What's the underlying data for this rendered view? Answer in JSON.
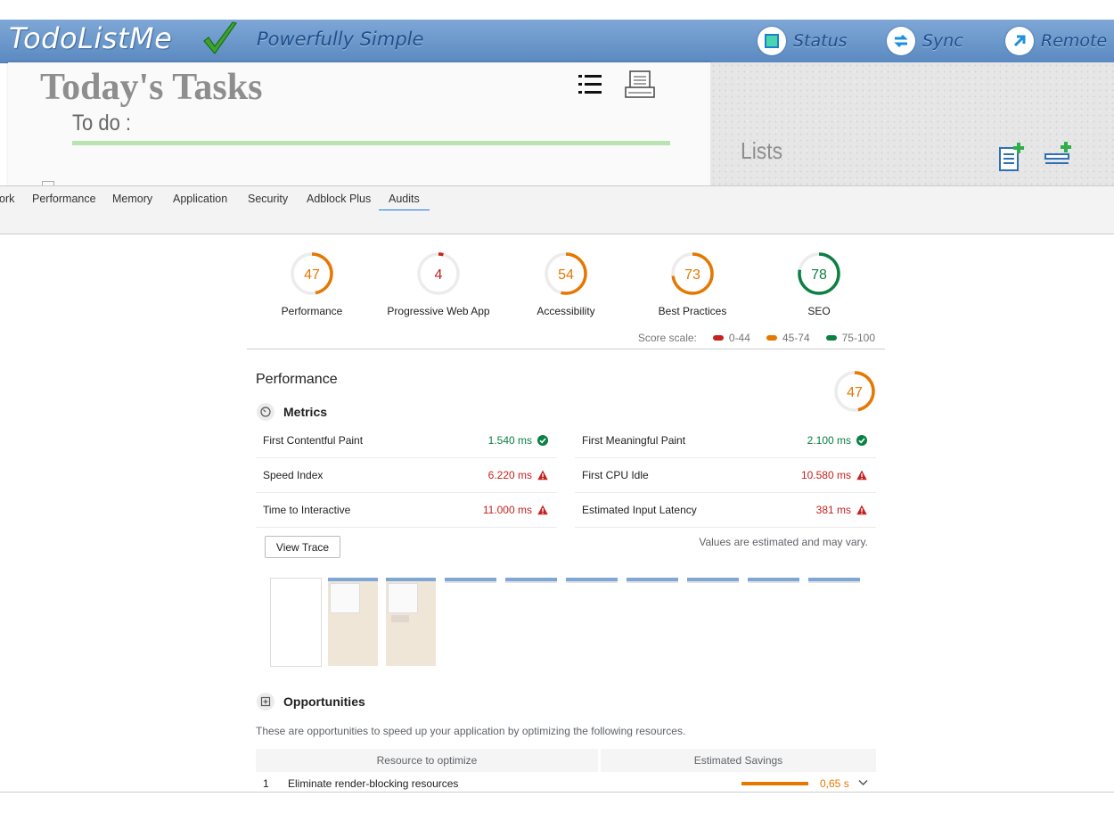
{
  "app": {
    "brand": "TodoListMe",
    "tagline": "Powerfully Simple",
    "header_buttons": [
      "Status",
      "Sync",
      "Remote"
    ],
    "tasks_title": "Today's Tasks",
    "todo_label": "To do :",
    "lists_label": "Lists"
  },
  "devtools": {
    "tabs": [
      "ork",
      "Performance",
      "Memory",
      "Application",
      "Security",
      "Adblock Plus",
      "Audits"
    ],
    "active_tab": "Audits"
  },
  "audits": {
    "gauges": [
      {
        "score": "47",
        "label": "Performance",
        "fraction": 0.47,
        "color": "#e67700"
      },
      {
        "score": "4",
        "label": "Progressive Web App",
        "fraction": 0.04,
        "color": "#c5221f"
      },
      {
        "score": "54",
        "label": "Accessibility",
        "fraction": 0.54,
        "color": "#e67700"
      },
      {
        "score": "73",
        "label": "Best Practices",
        "fraction": 0.73,
        "color": "#e67700"
      },
      {
        "score": "78",
        "label": "SEO",
        "fraction": 0.78,
        "color": "#0b8043"
      }
    ],
    "scale": {
      "label": "Score scale:",
      "ranges": [
        {
          "text": "0-44",
          "color": "#c5221f"
        },
        {
          "text": "45-74",
          "color": "#e67700"
        },
        {
          "text": "75-100",
          "color": "#0b8043"
        }
      ]
    },
    "performance": {
      "title": "Performance",
      "score": "47",
      "fraction": 0.47,
      "metrics_title": "Metrics",
      "metrics": [
        {
          "name": "First Contentful Paint",
          "value": "1.540 ms",
          "status": "good"
        },
        {
          "name": "First Meaningful Paint",
          "value": "2.100 ms",
          "status": "good"
        },
        {
          "name": "Speed Index",
          "value": "6.220 ms",
          "status": "bad"
        },
        {
          "name": "First CPU Idle",
          "value": "10.580 ms",
          "status": "bad"
        },
        {
          "name": "Time to Interactive",
          "value": "11.000 ms",
          "status": "bad"
        },
        {
          "name": "Estimated Input Latency",
          "value": "381 ms",
          "status": "bad"
        }
      ],
      "view_trace": "View Trace",
      "estimate_note": "Values are estimated and may vary.",
      "opportunities_title": "Opportunities",
      "opportunities_desc": "These are opportunities to speed up your application by optimizing the following resources.",
      "opp_headers": [
        "Resource to optimize",
        "Estimated Savings"
      ],
      "opportunities": [
        {
          "index": "1",
          "name": "Eliminate render-blocking resources",
          "savings": "0,65 s"
        }
      ]
    }
  }
}
